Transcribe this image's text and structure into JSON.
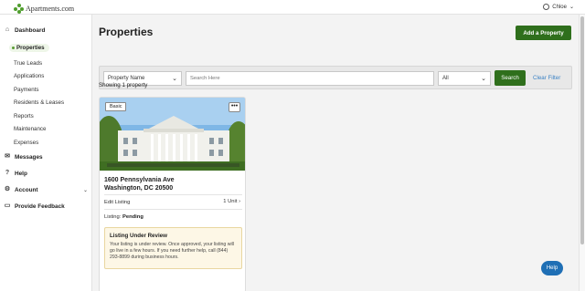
{
  "brand": {
    "name": "Apartments.com",
    "accent": "#2f6f1c"
  },
  "header": {
    "user_name": "Chloe",
    "user_icon": "user-circle-icon"
  },
  "sidebar": {
    "dashboard": "Dashboard",
    "properties": "Properties",
    "sub_items": [
      "True Leads",
      "Applications",
      "Payments",
      "Residents & Leases",
      "Reports",
      "Maintenance",
      "Expenses"
    ],
    "messages": "Messages",
    "help": "Help",
    "account": "Account",
    "feedback": "Provide Feedback"
  },
  "main": {
    "title": "Properties",
    "add_button": "Add a Property",
    "filter": {
      "field_select": "Property Name",
      "search_placeholder": "Search Here",
      "status_select": "All",
      "search_button": "Search",
      "clear_filter": "Clear Filter"
    },
    "showing": "Showing 1 property"
  },
  "property": {
    "badge": "Basic",
    "more": "•••",
    "address_line1": "1600 Pennsylvania Ave",
    "address_line2": "Washington, DC 20500",
    "edit_listing": "Edit Listing",
    "units": "1 Unit",
    "listing_label": "Listing:",
    "listing_status": "Pending",
    "review_title": "Listing Under Review",
    "review_text": "Your listing is under review. Once approved, your listing will go live in a few hours. If you need further help, call (844) 293-8899 during business hours."
  },
  "help_button": "Help"
}
